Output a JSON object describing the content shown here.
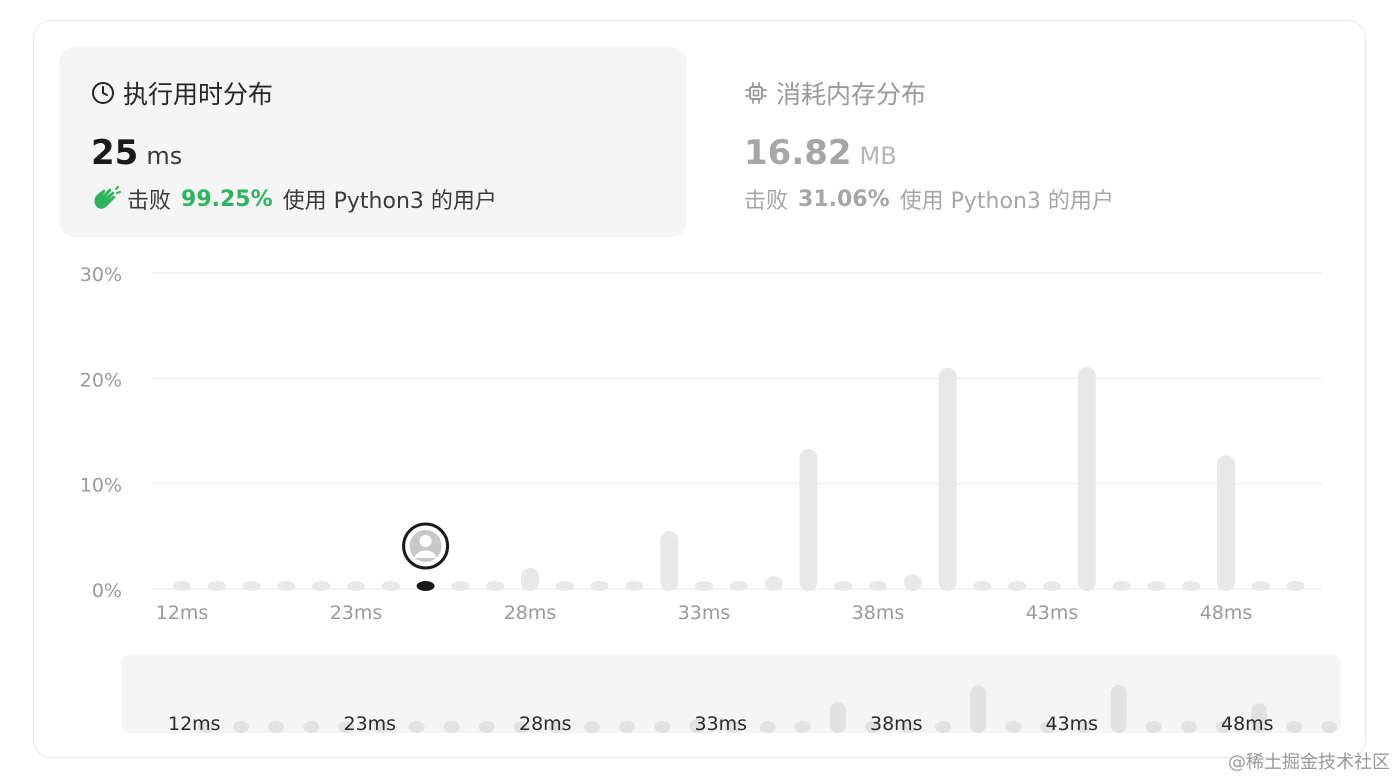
{
  "runtime_panel": {
    "title": "执行用时分布",
    "value": "25",
    "unit": "ms",
    "beats_prefix": "击败",
    "beats_pct": "99.25%",
    "beats_suffix": "使用 Python3 的用户",
    "icon": "clock-icon",
    "accent_color": "#2db55d"
  },
  "memory_panel": {
    "title": "消耗内存分布",
    "value": "16.82",
    "unit": "MB",
    "beats_prefix": "击败",
    "beats_pct": "31.06%",
    "beats_suffix": "使用 Python3 的用户",
    "icon": "chip-icon"
  },
  "watermark": "@稀土掘金技术社区",
  "chart_data": {
    "type": "bar",
    "ylabel": "",
    "xlabel": "",
    "ylim": [
      0,
      30
    ],
    "y_ticks": [
      "0%",
      "10%",
      "20%",
      "30%"
    ],
    "x_ticks": [
      "12ms",
      "23ms",
      "28ms",
      "33ms",
      "38ms",
      "43ms",
      "48ms"
    ],
    "values": [
      0.3,
      0.3,
      0.3,
      0.3,
      0.3,
      0.3,
      0.3,
      0.3,
      0.3,
      0.3,
      2.0,
      0.3,
      0.3,
      0.3,
      5.5,
      0.3,
      0.3,
      1.2,
      13.3,
      0.3,
      0.3,
      1.4,
      21.0,
      0.3,
      0.3,
      0.3,
      21.1,
      0.3,
      0.3,
      0.3,
      12.7,
      0.3,
      0.3
    ],
    "highlight_index": 7,
    "bar_color": "#e8e8e8",
    "highlight_color": "#1a1a1a",
    "grid": true
  }
}
